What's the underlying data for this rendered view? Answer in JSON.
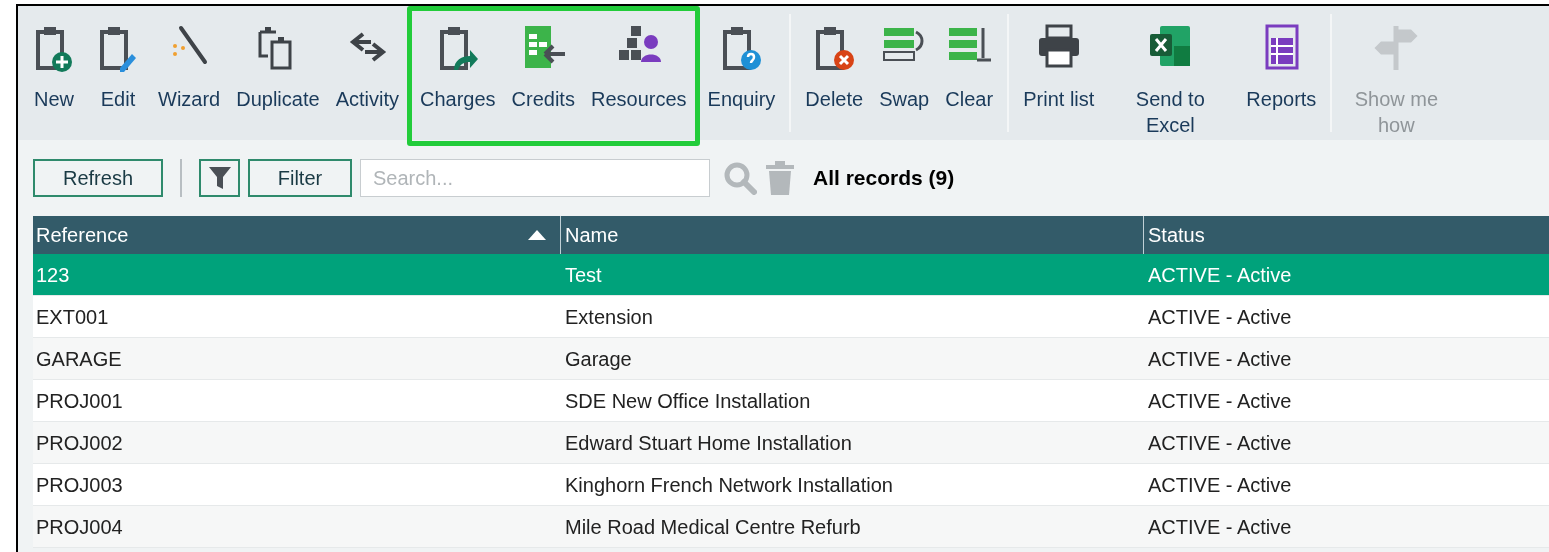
{
  "toolbar": {
    "groups": [
      {
        "highlighted": false,
        "items": [
          {
            "label": "New",
            "disabled": false
          },
          {
            "label": "Edit",
            "disabled": false
          },
          {
            "label": "Wizard",
            "disabled": false
          },
          {
            "label": "Duplicate",
            "disabled": false
          },
          {
            "label": "Activity",
            "disabled": false
          }
        ]
      },
      {
        "highlighted": true,
        "items": [
          {
            "label": "Charges",
            "disabled": false
          },
          {
            "label": "Credits",
            "disabled": false
          },
          {
            "label": "Resources",
            "disabled": false
          }
        ]
      },
      {
        "highlighted": false,
        "items": [
          {
            "label": "Enquiry",
            "disabled": false
          }
        ]
      },
      {
        "highlighted": false,
        "separator": true,
        "items": [
          {
            "label": "Delete",
            "disabled": false
          },
          {
            "label": "Swap",
            "disabled": false
          },
          {
            "label": "Clear",
            "disabled": false
          }
        ]
      },
      {
        "highlighted": false,
        "separator": true,
        "items": [
          {
            "label": "Print list",
            "disabled": false
          },
          {
            "label": "Send to Excel",
            "disabled": false
          },
          {
            "label": "Reports",
            "disabled": false
          }
        ]
      },
      {
        "highlighted": false,
        "separator": true,
        "items": [
          {
            "label": "Show me how",
            "disabled": true
          }
        ]
      }
    ]
  },
  "filter_bar": {
    "refresh": "Refresh",
    "filter": "Filter",
    "search": {
      "placeholder": "Search..."
    },
    "records": "All records (9)"
  },
  "table": {
    "columns": [
      "Reference",
      "Name",
      "Status"
    ],
    "rows": [
      {
        "cells": [
          "123",
          "Test",
          "ACTIVE - Active"
        ],
        "selected": true
      },
      {
        "cells": [
          "EXT001",
          "Extension",
          "ACTIVE - Active"
        ],
        "selected": false
      },
      {
        "cells": [
          "GARAGE",
          "Garage",
          "ACTIVE - Active"
        ],
        "selected": false
      },
      {
        "cells": [
          "PROJ001",
          "SDE New Office Installation",
          "ACTIVE - Active"
        ],
        "selected": false
      },
      {
        "cells": [
          "PROJ002",
          "Edward Stuart Home Installation",
          "ACTIVE - Active"
        ],
        "selected": false
      },
      {
        "cells": [
          "PROJ003",
          "Kinghorn French Network Installation",
          "ACTIVE - Active"
        ],
        "selected": false
      },
      {
        "cells": [
          "PROJ004",
          "Mile Road Medical Centre Refurb",
          "ACTIVE - Active"
        ],
        "selected": false
      }
    ]
  }
}
